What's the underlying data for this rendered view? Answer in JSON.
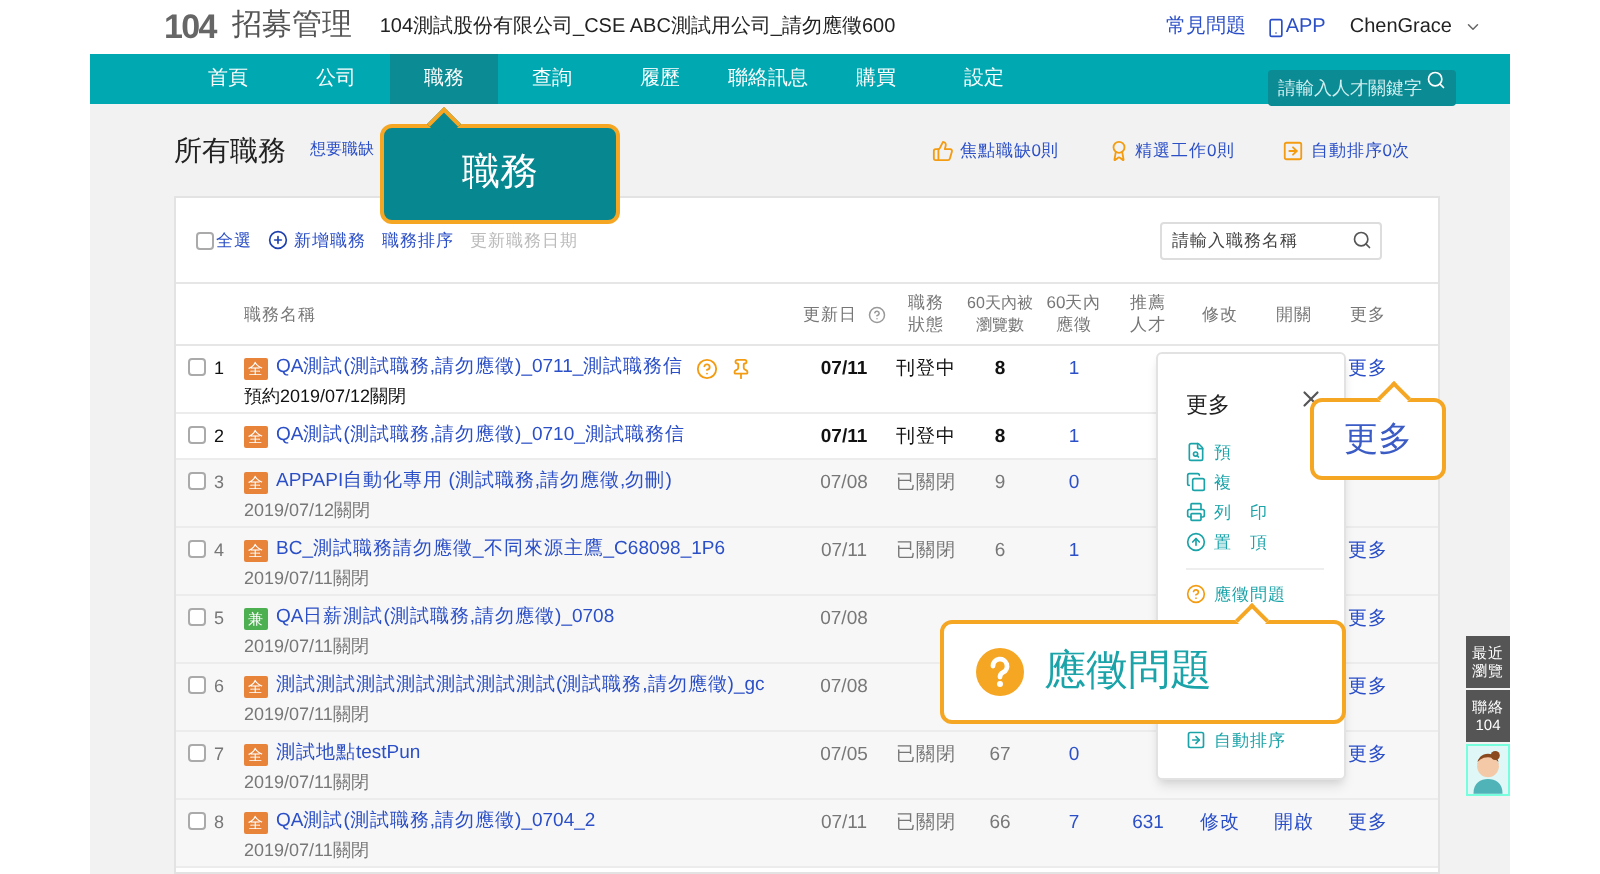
{
  "header": {
    "logo": "104",
    "product": "招募管理",
    "company": "104測試股份有限公司_CSE ABC測試用公司_請勿應徵600",
    "links": [
      {
        "kind": "text",
        "label": "常見問題"
      },
      {
        "kind": "app",
        "label": "APP"
      }
    ],
    "user": "ChenGrace"
  },
  "nav": {
    "items": [
      {
        "label": "首頁",
        "selected": false
      },
      {
        "label": "公司",
        "selected": false
      },
      {
        "label": "職務",
        "selected": true
      },
      {
        "label": "查詢",
        "selected": false
      },
      {
        "label": "履歷",
        "selected": false
      },
      {
        "label": "聯絡訊息",
        "selected": false
      },
      {
        "label": "購買",
        "selected": false
      },
      {
        "label": "設定",
        "selected": false
      }
    ],
    "search": {
      "placeholder": "請輸入人才關鍵字"
    }
  },
  "page": {
    "title": "所有職務",
    "link": "想要職缺",
    "stats": [
      {
        "kind": "thumb",
        "label": "焦點職缺0則"
      },
      {
        "kind": "badge",
        "label": "精選工作0則"
      },
      {
        "kind": "sort",
        "label": "自動排序0次"
      }
    ]
  },
  "toolbar": {
    "select_all": {
      "label": "全選",
      "checked": false
    },
    "actions": [
      {
        "kind": "add",
        "label": "新增職務",
        "disabled": false
      },
      {
        "kind": "plain",
        "label": "職務排序",
        "disabled": false
      },
      {
        "kind": "plain",
        "label": "更新職務日期",
        "disabled": true
      }
    ],
    "search": {
      "placeholder": "請輸入職務名稱"
    }
  },
  "table": {
    "columns": [
      {
        "label": "職務名稱"
      },
      {
        "label": "更新日",
        "help": true
      },
      {
        "label": "職務狀態"
      },
      {
        "label": "60天內被瀏覽數"
      },
      {
        "label": "60天內應徵"
      },
      {
        "label": "推薦人才"
      },
      {
        "label": "修改"
      },
      {
        "label": "開關"
      },
      {
        "label": "更多"
      }
    ],
    "rows": [
      {
        "number": "1",
        "checked": false,
        "open": true,
        "badge": {
          "text": "全",
          "color": "#e8833a"
        },
        "title": "QA測試(測試職務,請勿應徵)_0711_測試職務信",
        "icons": [
          {
            "kind": "question"
          },
          {
            "kind": "pin"
          }
        ],
        "note": "預約2019/07/12關閉",
        "date": "07/11",
        "status": "刊登中",
        "views": "8",
        "applies": "1",
        "more": "更多"
      },
      {
        "number": "2",
        "checked": false,
        "open": true,
        "badge": {
          "text": "全",
          "color": "#e8833a"
        },
        "title": "QA測試(測試職務,請勿應徵)_0710_測試職務信",
        "date": "07/11",
        "status": "刊登中",
        "views": "8",
        "applies": "1"
      },
      {
        "number": "3",
        "checked": false,
        "open": false,
        "badge": {
          "text": "全",
          "color": "#e8833a"
        },
        "title": "APPAPI自動化專用 (測試職務,請勿應徵,勿刪)",
        "note": "2019/07/12關閉",
        "date": "07/08",
        "status": "已關閉",
        "views": "9",
        "applies": "0"
      },
      {
        "number": "4",
        "checked": false,
        "open": false,
        "badge": {
          "text": "全",
          "color": "#e8833a"
        },
        "title": "BC_測試職務請勿應徵_不同來源主鷹_C68098_1P6",
        "note": "2019/07/11關閉",
        "date": "07/11",
        "status": "已關閉",
        "views": "6",
        "applies": "1",
        "more": "更多"
      },
      {
        "number": "5",
        "checked": false,
        "open": false,
        "badge": {
          "text": "兼",
          "color": "#4caf50"
        },
        "title": "QA日薪測試(測試職務,請勿應徵)_0708",
        "note": "2019/07/11關閉",
        "date": "07/08",
        "more": "更多"
      },
      {
        "number": "6",
        "checked": false,
        "open": false,
        "badge": {
          "text": "全",
          "color": "#e8833a"
        },
        "title": "測試測試測試測試測試測試測試(測試職務,請勿應徵)_gc",
        "note": "2019/07/11關閉",
        "date": "07/08",
        "more": "更多"
      },
      {
        "number": "7",
        "checked": false,
        "open": false,
        "badge": {
          "text": "全",
          "color": "#e8833a"
        },
        "title": "測試地點testPun",
        "note": "2019/07/11關閉",
        "date": "07/05",
        "status": "已關閉",
        "views": "67",
        "applies": "0",
        "more": "更多"
      },
      {
        "number": "8",
        "checked": false,
        "open": false,
        "badge": {
          "text": "全",
          "color": "#e8833a"
        },
        "title": "QA測試(測試職務,請勿應徵)_0704_2",
        "note": "2019/07/11關閉",
        "date": "07/11",
        "status": "已關閉",
        "views": "66",
        "applies": "7",
        "recommend": "631",
        "edit": "修改",
        "toggle": "開啟",
        "more": "更多"
      }
    ]
  },
  "more_menu": {
    "title": "更多",
    "items": [
      {
        "kind": "preview",
        "label": "預"
      },
      {
        "kind": "copy",
        "label": "複"
      },
      {
        "kind": "print",
        "label": "列　印"
      },
      {
        "kind": "top",
        "label": "置　頂"
      }
    ],
    "items2": [
      {
        "kind": "question",
        "label": "應徵問題"
      },
      {
        "kind": "sort",
        "label": "自動排序"
      }
    ]
  },
  "callouts": [
    {
      "kind": "nav",
      "text": "職務"
    },
    {
      "kind": "more",
      "text": "更多"
    },
    {
      "kind": "question",
      "text": "應徵問題"
    }
  ],
  "side": [
    {
      "label": "最近瀏覽"
    },
    {
      "label": "聯絡104"
    }
  ]
}
